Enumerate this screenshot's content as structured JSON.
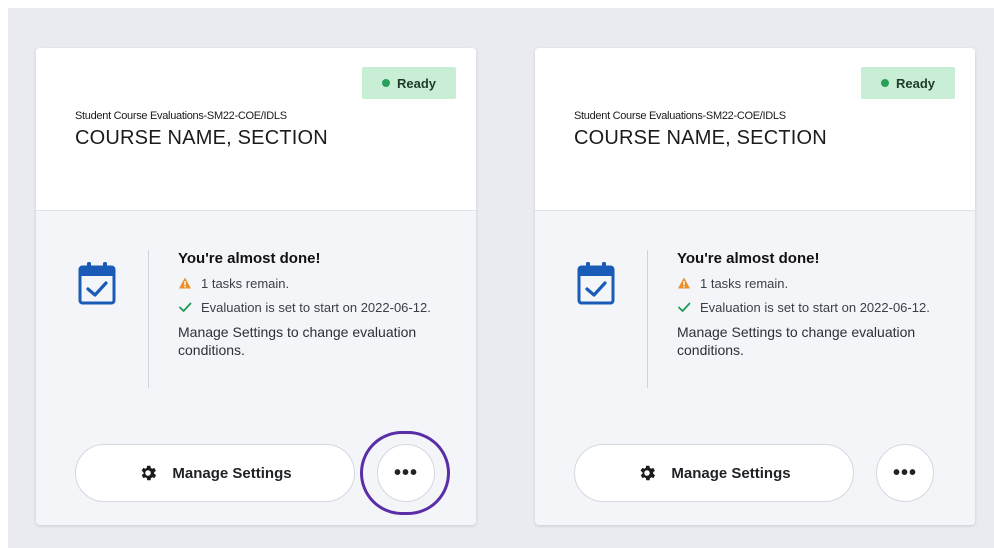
{
  "cards": [
    {
      "status_badge": "Ready",
      "evaluation_code": "Student Course Evaluations-SM22-COE/IDLS",
      "course_title": "COURSE NAME, SECTION",
      "progress_title": "You're almost done!",
      "tasks_text": "1 tasks remain.",
      "start_text": "Evaluation is set to start on 2022-06-12.",
      "note_text": "Manage Settings to change evaluation conditions.",
      "manage_label": "Manage Settings",
      "more_label": "•••"
    },
    {
      "status_badge": "Ready",
      "evaluation_code": "Student Course Evaluations-SM22-COE/IDLS",
      "course_title": "COURSE NAME, SECTION",
      "progress_title": "You're almost done!",
      "tasks_text": "1 tasks remain.",
      "start_text": "Evaluation is set to start on 2022-06-12.",
      "note_text": "Manage Settings to change evaluation conditions.",
      "manage_label": "Manage Settings",
      "more_label": "•••"
    }
  ],
  "colors": {
    "badge_bg": "#c8efd5",
    "badge_dot": "#27a05a",
    "calendar_icon": "#1a5bb8",
    "warning_icon": "#e8902a",
    "check_icon": "#1f9a57",
    "focus_ring": "#5a2ea6"
  },
  "icons": {
    "calendar": "calendar-check-icon",
    "warning": "warning-icon",
    "check": "check-icon",
    "settings": "gear-icon",
    "more": "more-dots-icon"
  }
}
